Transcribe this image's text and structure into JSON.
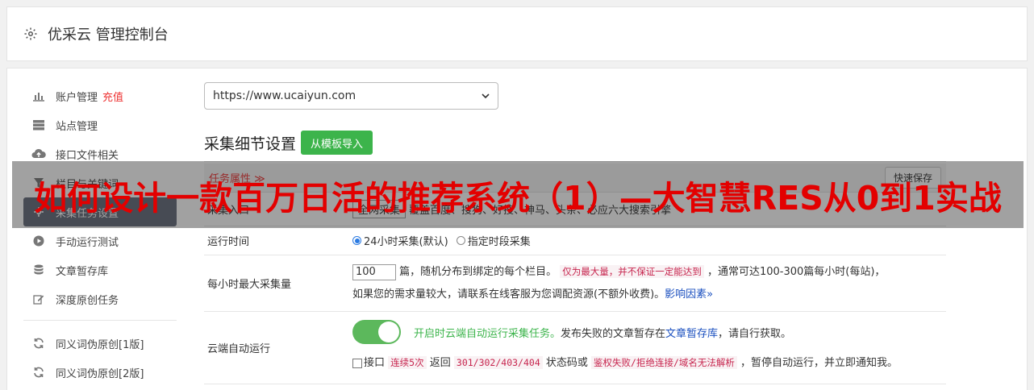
{
  "header": {
    "title": "优采云 管理控制台",
    "icon": "gear-icon"
  },
  "sidebar": {
    "items": [
      {
        "label": "账户管理",
        "badge": "充值",
        "icon": "bar-chart-icon"
      },
      {
        "label": "站点管理",
        "icon": "server-icon"
      },
      {
        "label": "接口文件相关",
        "icon": "cloud-upload-icon"
      },
      {
        "label": "栏目与关键词",
        "icon": "filter-icon"
      },
      {
        "label": "采集任务设置",
        "icon": "gear-icon"
      },
      {
        "label": "手动运行测试",
        "icon": "play-icon"
      },
      {
        "label": "文章暂存库",
        "icon": "database-icon"
      },
      {
        "label": "深度原创任务",
        "icon": "edit-icon"
      },
      {
        "label": "同义词伪原创[1版]",
        "icon": "refresh-icon"
      },
      {
        "label": "同义词伪原创[2版]",
        "icon": "refresh-icon"
      }
    ]
  },
  "main": {
    "site_select": "https://www.ucaiyun.com",
    "section_title": "采集细节设置",
    "import_button": "从模板导入",
    "task_attr": "任务属性 ≫",
    "save_button": "快速保存",
    "rows": {
      "entry": {
        "label": "采集入口",
        "select": "全网采集",
        "desc": "覆盖百度、搜狗、好搜、神马、头条、必应六大搜索引擎"
      },
      "runtime": {
        "label": "运行时间",
        "option1": "24小时采集(默认)",
        "option2": "指定时段采集"
      },
      "maxrate": {
        "label": "每小时最大采集量",
        "value": "100",
        "text1": "篇，随机分布到绑定的每个栏目。",
        "code1": "仅为最大量，并不保证一定能达到",
        "text2": "，通常可达100-300篇每小时(每站)，",
        "text3": "如果您的需求量较大，请联系在线客服为您调配资源(不额外收费)。",
        "link": "影响因素"
      },
      "cloud": {
        "label": "云端自动运行",
        "green_text": "开启时云端自动运行采集任务。",
        "text1": "发布失败的文章暂存在",
        "link": "文章暂存库",
        "text2": "，请自行获取。",
        "chk_text": "接口",
        "code1": "连续5次",
        "text3": "返回",
        "code2": "301/302/403/404",
        "text4": "状态码或",
        "code3": "鉴权失败/拒绝连接/域名无法解析",
        "text5": "，暂停自动运行，并立即通知我。"
      }
    }
  },
  "overlay": {
    "text": "如何设计一款百万日活的推荐系统（1）—大智慧RES从0到1实战"
  },
  "colors": {
    "accent_green": "#3cb44b",
    "active_nav": "#646c7a",
    "badge_red": "#e33",
    "overlay_red": "#e30000"
  }
}
